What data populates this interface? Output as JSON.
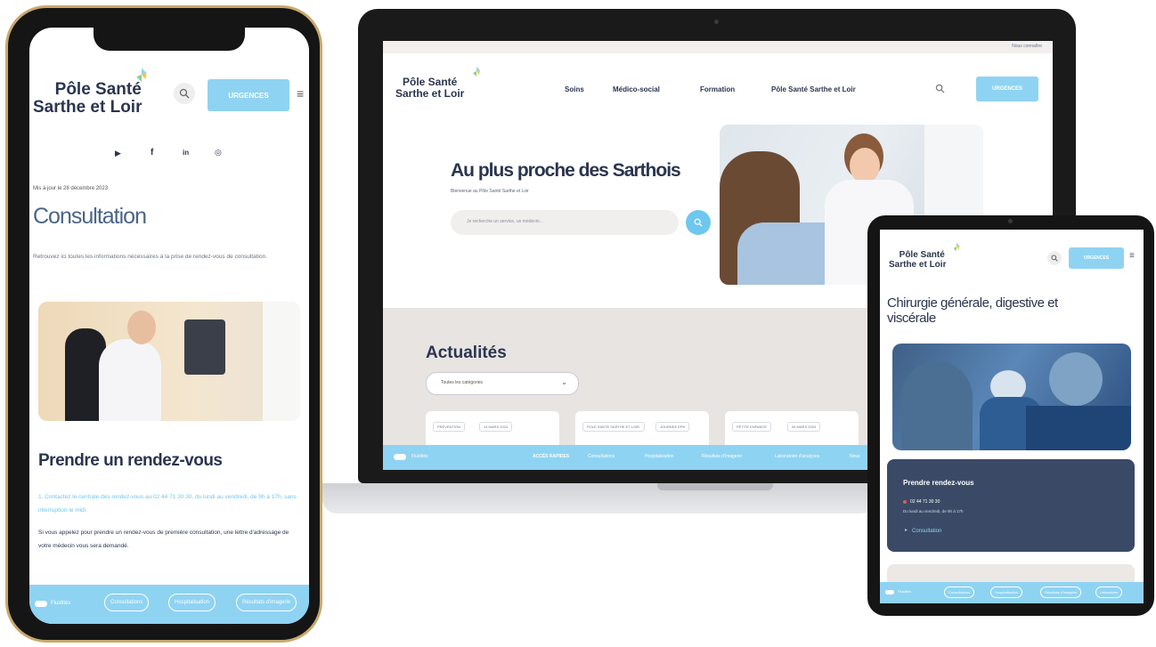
{
  "brand": {
    "line1": "Pôle Santé",
    "line2": "Sarthe et Loir"
  },
  "colors": {
    "accent": "#8fd3f2",
    "dark": "#2b3550",
    "bezel": "#1c1c1c",
    "band": "#e8e4e2",
    "navy_card": "#3a4a66"
  },
  "laptop": {
    "topbar_text": "Nous connaître",
    "nav": [
      "Soins",
      "Médico-social",
      "Formation",
      "Pôle Santé Sarthe et Loir"
    ],
    "urgences": "URGENCES",
    "hero_title": "Au plus proche des Sarthois",
    "hero_sub": "Bienvenue au Pôle Santé Sarthe et Loir",
    "search_placeholder": "Je recherche un service, un médecin...",
    "news_title": "Actualités",
    "filter": "Toutes les catégories",
    "card_tags": [
      [
        "PRÉVENTION",
        "14 MARS 2024"
      ],
      [
        "POLE SANTE SARTHE ET LOIR",
        "JOURNEE EPH"
      ],
      [
        "PETITE ENFANCE",
        "06 MARS 2024"
      ]
    ],
    "bottom_bar": {
      "toggle": "Fluidités",
      "items": [
        "ACCÈS RAPIDES",
        "Consultations",
        "Hospitalisation",
        "Résultats d'imagerie",
        "Laboratoire d'analyses",
        "Nous"
      ]
    }
  },
  "phone": {
    "urgences": "URGENCES",
    "social": [
      "▶",
      "f",
      "in",
      "◎"
    ],
    "date": "Mis à jour le 28 décembre 2023",
    "page_title": "Consultation",
    "intro": "Retrouvez ici toutes les informations nécessaires à la prise de rendez-vous de consultation.",
    "rdv_title": "Prendre un rendez-vous",
    "step1": "1. Contactez le centrale des rendez-vous au 02 44 71 30 30, du lundi au vendredi, de 9h à 17h, sans interruption le midi.",
    "para2": "Si vous appelez pour prendre un rendez-vous de première consultation, une lettre d'adressage de votre médecin vous sera demandé.",
    "bottom": {
      "toggle": "Fluidités",
      "items": [
        "Consultations",
        "Hospitalisation",
        "Résultats d'imagerie"
      ]
    }
  },
  "tablet": {
    "urgences": "URGENCES",
    "page_title": "Chirurgie générale, digestive et viscérale",
    "card_title": "Prendre rendez-vous",
    "card_phone": "02 44 71 30 30",
    "card_hours": "Du lundi au vendredi, de 9h à 17h",
    "card_link": "Consultation",
    "bottom": {
      "toggle": "Fluidités",
      "items": [
        "Consultations",
        "Hospitalisation",
        "Résultats d'imagerie",
        "Laboratoire"
      ]
    }
  }
}
